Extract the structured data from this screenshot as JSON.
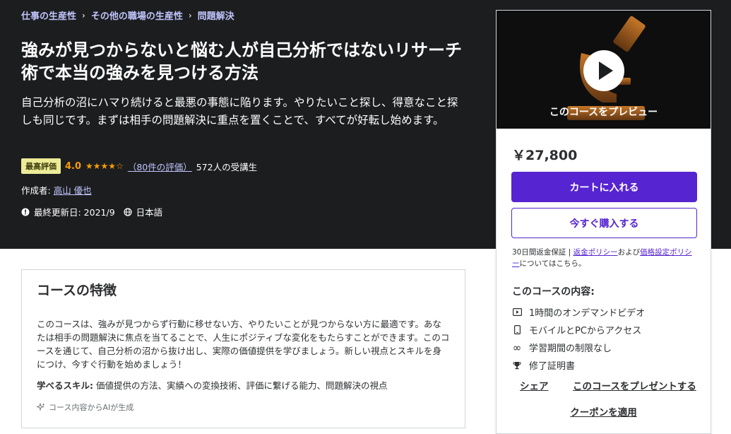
{
  "breadcrumb": [
    "仕事の生産性",
    "その他の職場の生産性",
    "問題解決"
  ],
  "course": {
    "title": "強みが見つからないと悩む人が自己分析ではないリサーチ術で本当の強みを見つける方法",
    "subtitle": "自己分析の沼にハマり続けると最悪の事態に陥ります。やりたいこと探し、得意なこと探しも同じです。まずは相手の問題解決に重点を置くことで、すべてが好転し始めます。",
    "badge": "最高評価",
    "rating": "4.0",
    "stars": "★★★★☆",
    "rating_value": 4.0,
    "reviews": "（80件の評価）",
    "students": "572人の受講生",
    "author_label": "作成者:",
    "author": "高山 優也",
    "updated": "最終更新日: 2021/9",
    "language": "日本語"
  },
  "sidebar": {
    "preview_label": "このコースをプレビュー",
    "price": "￥27,800",
    "cart_button": "カートに入れる",
    "buy_button": "今すぐ購入する",
    "guarantee_prefix": "30日間返金保証 | ",
    "refund_link": "返金ポリシー",
    "guarantee_mid": "および",
    "pricing_link": "価格設定ポリシー",
    "guarantee_suffix": "についてはこちら。",
    "includes_title": "このコースの内容:",
    "includes": [
      {
        "icon": "video-icon",
        "text": "1時間のオンデマンドビデオ"
      },
      {
        "icon": "mobile-icon",
        "text": "モバイルとPCからアクセス"
      },
      {
        "icon": "infinity-icon",
        "text": "学習期間の制限なし"
      },
      {
        "icon": "trophy-icon",
        "text": "修了証明書"
      }
    ],
    "share": "シェア",
    "gift": "このコースをプレゼントする",
    "coupon": "クーポンを適用"
  },
  "features": {
    "title": "コースの特徴",
    "body": "このコースは、強みが見つからず行動に移せない方、やりたいことが見つからない方に最適です。あなたは相手の問題解決に焦点を当てることで、人生にポジティブな変化をもたらすことができます。このコースを通じて、自己分析の沼から抜け出し、実際の価値提供を学びましょう。新しい視点とスキルを身につけ、今すぐ行動を始めましょう！",
    "skills_label": "学べるスキル:",
    "skills": " 価値提供の方法、実績への変換技術、評価に繋げる能力、問題解決の視点",
    "ai_note": "コース内容からAIが生成"
  },
  "colors": {
    "hero_bg": "#1c1d1f",
    "accent": "#5624d0",
    "link_light": "#c0c4fc",
    "star": "#f69c08",
    "badge_bg": "#eceb98"
  }
}
